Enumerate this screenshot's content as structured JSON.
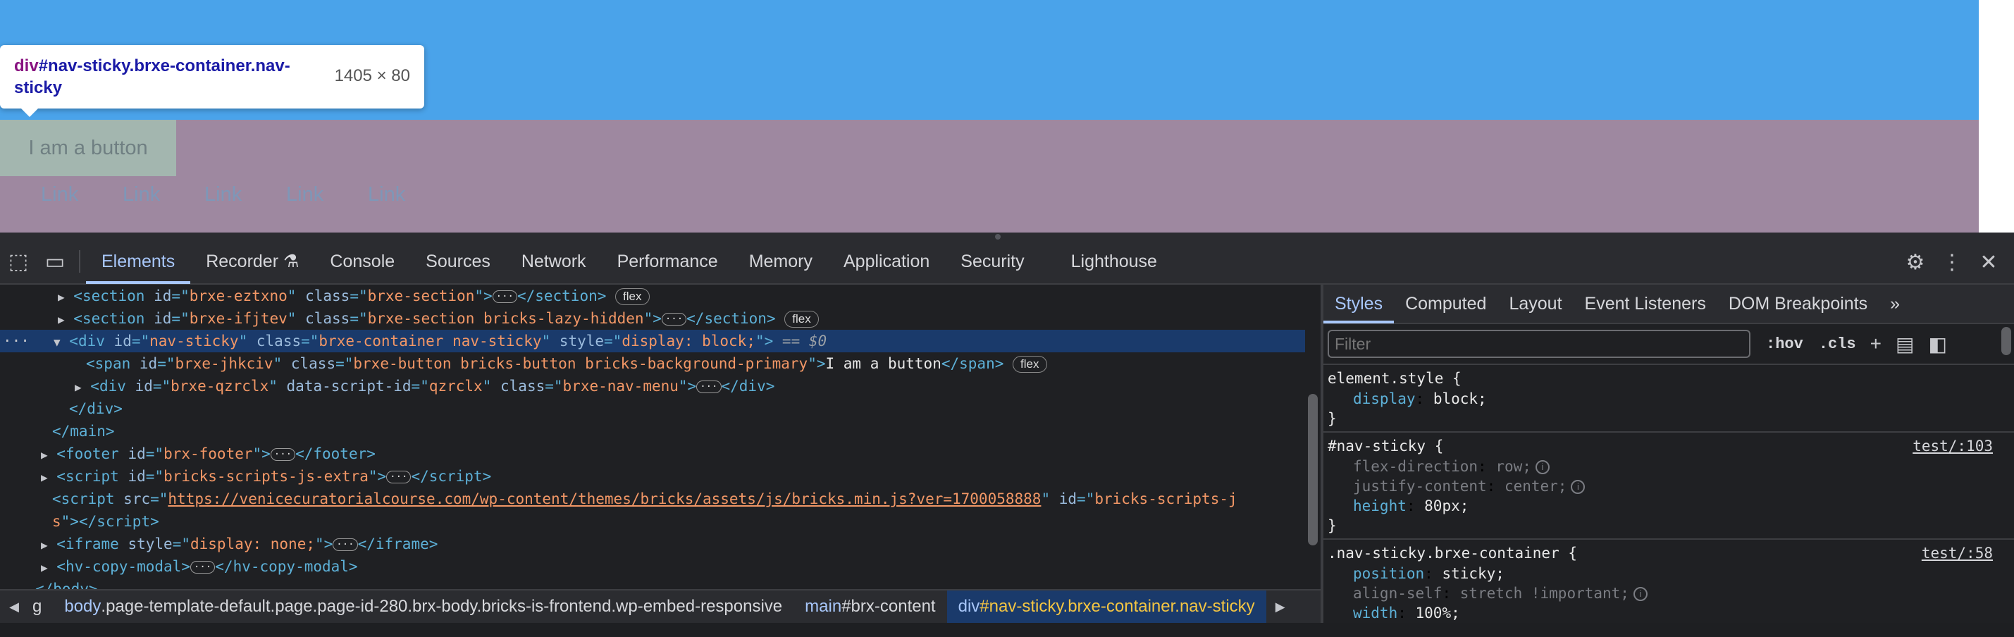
{
  "preview": {
    "button_label": "I am a button",
    "links": [
      "Link",
      "Link",
      "Link",
      "Link",
      "Link"
    ],
    "tooltip": {
      "tag": "div",
      "selector_rest": "#nav-sticky.brxe-container.nav-sticky",
      "size": "1405 × 80"
    }
  },
  "devtools": {
    "tabs": [
      "Elements",
      "Recorder",
      "Console",
      "Sources",
      "Network",
      "Performance",
      "Memory",
      "Application",
      "Security",
      "Lighthouse"
    ],
    "active_tab": "Elements",
    "recorder_icon": "flask-icon",
    "dom": {
      "l1": {
        "tag": "section",
        "id": "brxe-eztxno",
        "cls": "brxe-section",
        "badge": "flex"
      },
      "l2": {
        "tag": "section",
        "id": "brxe-ifjtev",
        "cls": "brxe-section bricks-lazy-hidden",
        "badge": "flex"
      },
      "l3": {
        "tag": "div",
        "id": "nav-sticky",
        "cls": "brxe-container nav-sticky",
        "style": "display: block;",
        "eq": "== $0"
      },
      "l4": {
        "tag": "span",
        "id": "brxe-jhkciv",
        "cls": "brxe-button bricks-button bricks-background-primary",
        "text": "I am a button",
        "badge": "flex"
      },
      "l5": {
        "tag": "div",
        "id": "brxe-qzrclx",
        "attr": "data-script-id",
        "attr_val": "qzrclx",
        "cls": "brxe-nav-menu"
      },
      "l6": "</div>",
      "l7": "</main>",
      "l8": {
        "tag": "footer",
        "id": "brx-footer"
      },
      "l9": {
        "tag": "script",
        "id": "bricks-scripts-js-extra"
      },
      "l10": {
        "src": "https://venicecuratorialcourse.com/wp-content/themes/bricks/assets/js/bricks.min.js?ver=1700058888",
        "id_start": "bricks-scripts-j",
        "id_end": "s"
      },
      "l11": {
        "tag": "iframe",
        "style": "display: none;"
      },
      "l12": {
        "tag": "hv-copy-modal"
      },
      "l13": "</body>"
    },
    "breadcrumbs": [
      {
        "tag": "",
        "cls": "g"
      },
      {
        "tag": "body",
        "cls": ".page-template-default.page.page-id-280.brx-body.bricks-is-frontend.wp-embed-responsive"
      },
      {
        "tag": "main",
        "cls": "#brx-content"
      },
      {
        "tag": "div",
        "cls": "#nav-sticky.brxe-container.nav-sticky"
      }
    ],
    "styles_tabs": [
      "Styles",
      "Computed",
      "Layout",
      "Event Listeners",
      "DOM Breakpoints"
    ],
    "filter_placeholder": "Filter",
    "hov": ":hov",
    "cls": ".cls",
    "rules": [
      {
        "selector": "element.style {",
        "src": "",
        "decls": [
          {
            "p": "display",
            "v": "block;"
          }
        ]
      },
      {
        "selector": "#nav-sticky {",
        "src": "test/:103",
        "decls": [
          {
            "p": "flex-direction",
            "v": "row;"
          },
          {
            "p": "justify-content",
            "v": "center;"
          },
          {
            "p": "height",
            "v": "80px;"
          }
        ]
      },
      {
        "selector": ".nav-sticky.brxe-container {",
        "src": "test/:58",
        "decls": [
          {
            "p": "position",
            "v": "sticky;"
          },
          {
            "p": "align-self",
            "v": "stretch !important;"
          },
          {
            "p": "width",
            "v": "100%;"
          }
        ]
      }
    ]
  }
}
